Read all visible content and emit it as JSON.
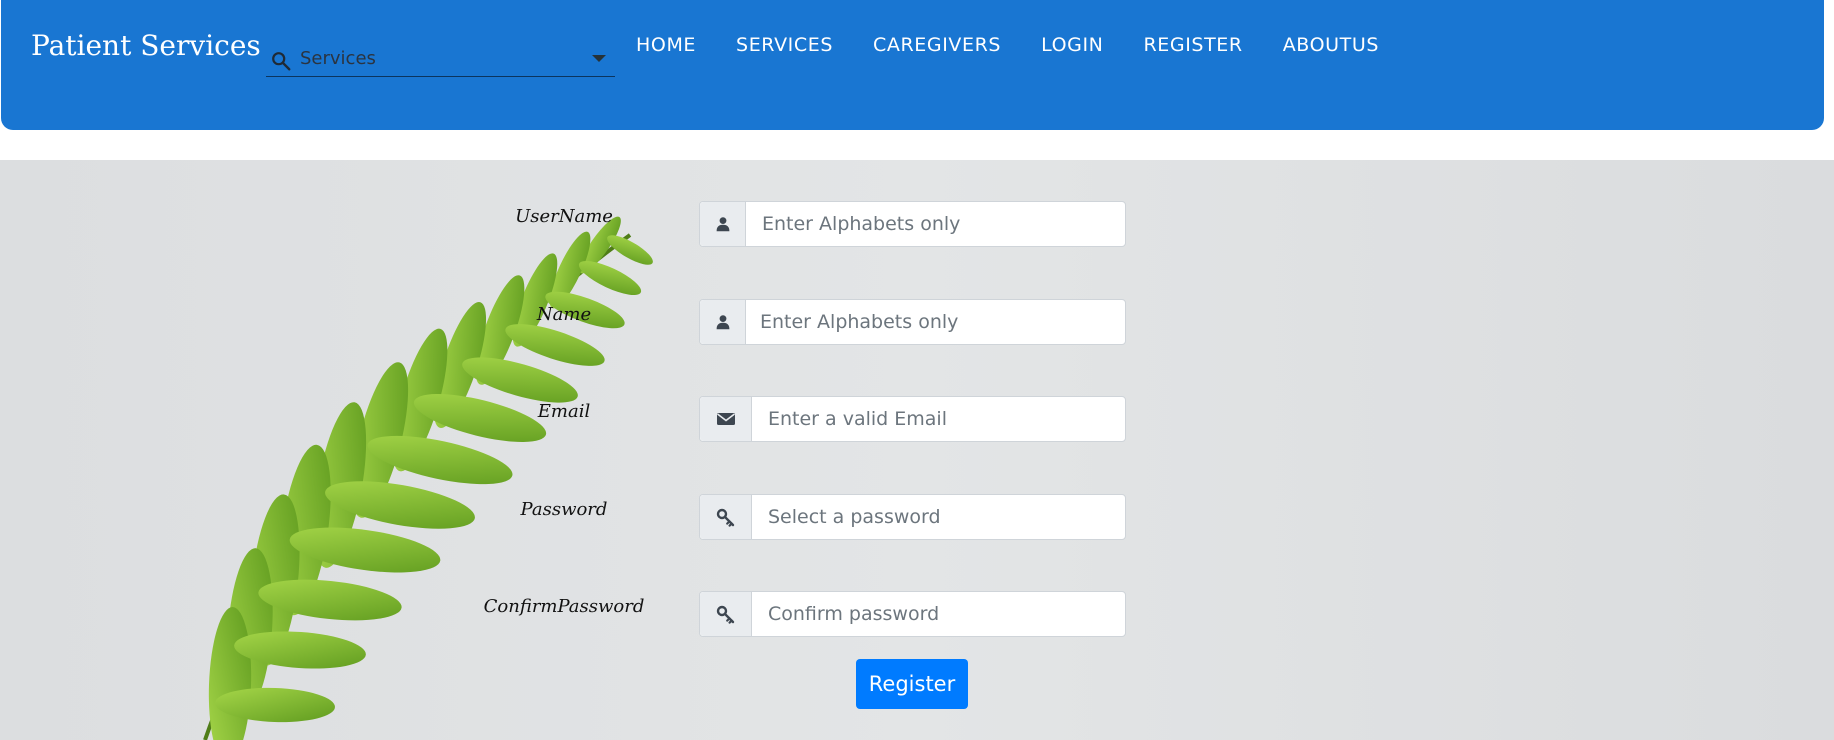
{
  "navbar": {
    "brand": "Patient Services",
    "search": {
      "value": "Services"
    },
    "links": [
      "HOME",
      "SERVICES",
      "CAREGIVERS",
      "LOGIN",
      "REGISTER",
      "ABOUTUS"
    ]
  },
  "form": {
    "username": {
      "label": "UserName",
      "placeholder": "Enter Alphabets only",
      "icon": "user-icon"
    },
    "name": {
      "label": "Name",
      "placeholder": "Enter Alphabets only",
      "icon": "user-icon"
    },
    "email": {
      "label": "Email",
      "placeholder": "Enter a valid Email",
      "icon": "envelope-icon"
    },
    "password": {
      "label": "Password",
      "placeholder": "Select a password",
      "icon": "key-icon"
    },
    "confirm_password": {
      "label": "ConfirmPassword",
      "placeholder": "Confirm password",
      "icon": "key-icon"
    },
    "submit_label": "Register"
  },
  "colors": {
    "navbar": "#1976d2",
    "button": "#007bff",
    "addon": "#e9ecef"
  }
}
